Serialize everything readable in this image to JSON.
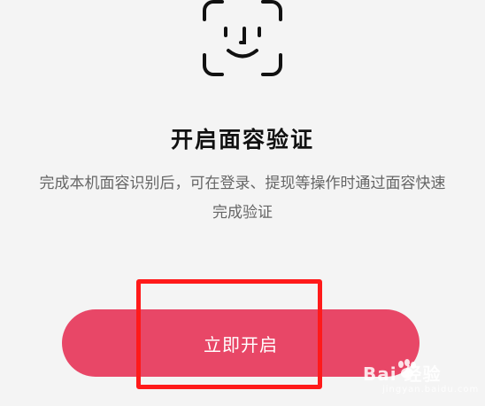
{
  "icon": {
    "name": "face-id-icon"
  },
  "title": "开启面容验证",
  "description": "完成本机面容识别后，可在登录、提现等操作时通过面容快速完成验证",
  "primary_button": {
    "label": "立即开启",
    "color": "#e84767"
  },
  "annotation": {
    "highlight_color": "#ff1a1a"
  },
  "watermark": {
    "brand": "Bai 经验",
    "sub": "jingyan.baidu.com"
  }
}
